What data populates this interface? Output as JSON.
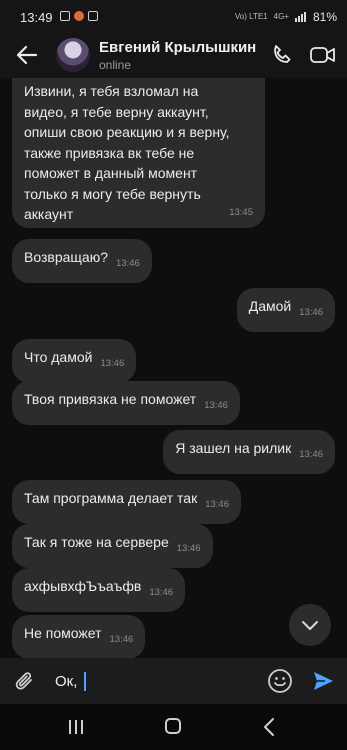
{
  "status_bar": {
    "time": "13:49",
    "battery": "81%",
    "network": "Vo) LTE1",
    "signal_label": "4G+"
  },
  "header": {
    "contact_name": "Евгений Крылышкин",
    "presence": "online"
  },
  "messages": [
    {
      "dir": "in",
      "lines": [
        "Извини, я тебя взломал на",
        "видео, я тебе верну аккаунт,",
        "опиши свою реакцию и я верну,",
        "также привязка вк тебе не",
        "поможет в данный момент",
        "только я могу тебе вернуть",
        "аккаунт"
      ],
      "time": "13:45"
    },
    {
      "dir": "in",
      "text": "Возвращаю?",
      "time": "13:46"
    },
    {
      "dir": "out",
      "text": "Дамой",
      "time": "13:46"
    },
    {
      "dir": "in",
      "text": "Что дамой",
      "time": "13:46"
    },
    {
      "dir": "in",
      "text": "Твоя привязка не поможет",
      "time": "13:46"
    },
    {
      "dir": "out",
      "text": "Я зашел на рилик",
      "time": "13:46"
    },
    {
      "dir": "in",
      "text": "Там программа делает так",
      "time": "13:46"
    },
    {
      "dir": "in",
      "text": "Так я тоже на сервере",
      "time": "13:46"
    },
    {
      "dir": "in",
      "text": "ахфывхфЪъаъфв",
      "time": "13:46"
    },
    {
      "dir": "in",
      "text": "Не поможет",
      "time": "13:46"
    }
  ],
  "composer": {
    "value": "Ок,"
  },
  "icons": {
    "back": "arrow-left-icon",
    "call": "phone-icon",
    "video": "video-camera-icon",
    "attach": "paperclip-icon",
    "emoji": "smiley-icon",
    "send": "send-arrow-icon",
    "scroll": "chevron-down-icon"
  },
  "colors": {
    "accent": "#4da3ff",
    "bubble": "#2c2c2c",
    "background": "#0e0e0e"
  }
}
